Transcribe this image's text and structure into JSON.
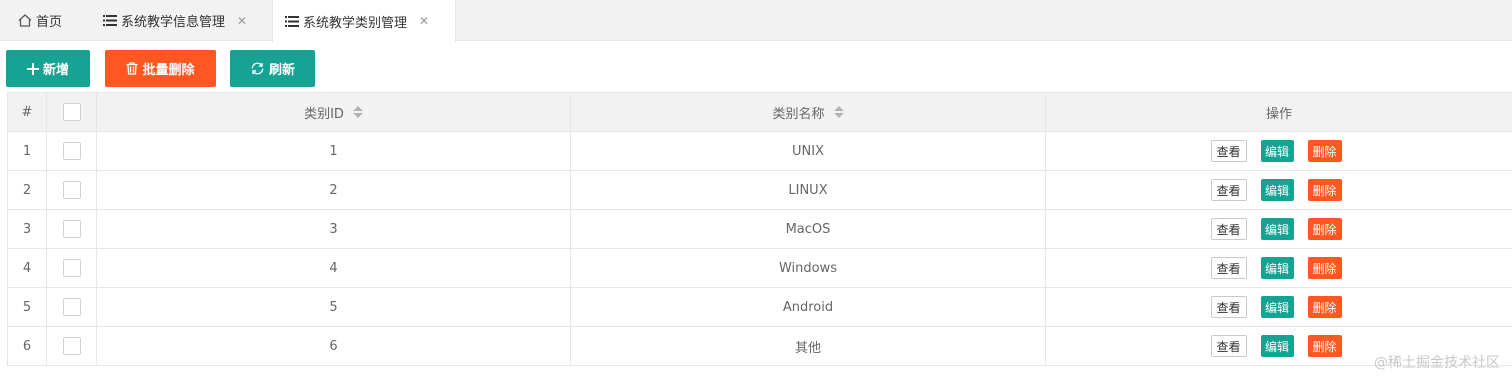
{
  "tabs": [
    {
      "label": "首页",
      "icon": "home-icon"
    },
    {
      "label": "系统教学信息管理",
      "icon": "list-icon"
    },
    {
      "label": "系统教学类别管理",
      "icon": "list-icon",
      "active": true
    }
  ],
  "toolbar": {
    "add_label": "新增",
    "batch_delete_label": "批量删除",
    "refresh_label": "刷新"
  },
  "table": {
    "headers": {
      "index": "#",
      "id": "类别ID",
      "name": "类别名称",
      "ops": "操作"
    },
    "rows": [
      {
        "index": "1",
        "id": "1",
        "name": "UNIX"
      },
      {
        "index": "2",
        "id": "2",
        "name": "LINUX"
      },
      {
        "index": "3",
        "id": "3",
        "name": "MacOS"
      },
      {
        "index": "4",
        "id": "4",
        "name": "Windows"
      },
      {
        "index": "5",
        "id": "5",
        "name": "Android"
      },
      {
        "index": "6",
        "id": "6",
        "name": "其他"
      }
    ],
    "actions": {
      "view": "查看",
      "edit": "编辑",
      "delete": "删除"
    }
  },
  "watermark": "@稀土掘金技术社区",
  "colors": {
    "primary": "#16a394",
    "danger": "#ff5722"
  }
}
